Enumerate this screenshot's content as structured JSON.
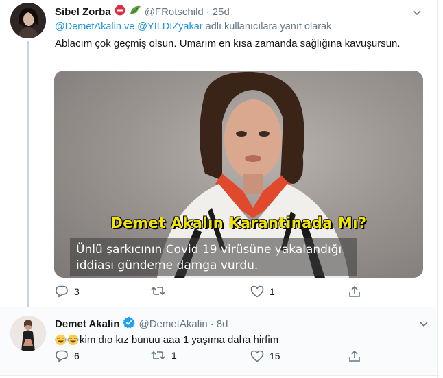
{
  "tweet1": {
    "name": "Sibel Zorba",
    "handle": "@FRotschild",
    "time": "25d",
    "reply_prefix": "",
    "reply_mention1": "@DemetAkalin",
    "reply_and": " ve ",
    "reply_mention2": "@YILDIZyakar",
    "reply_suffix": " adlı kullanıcılara yanıt olarak",
    "text": "Ablacım çok geçmiş olsun. Umarım en kısa zamanda sağlığına kavuşursun.",
    "media": {
      "headline": "Demet Akalın Karantinada Mı?",
      "caption": "Ünlü şarkıcının Covid 19 virüsüne yakalandığı iddiası  gündeme damga vurdu."
    },
    "reply_count": "3",
    "retweet_count": "",
    "like_count": "1",
    "badges": [
      "no-entry-icon",
      "leaf-icon"
    ]
  },
  "tweet2": {
    "name": "Demet Akalin",
    "handle": "@DemetAkalin",
    "time": "8d",
    "text": "kim dıo kız bunuu aaa 1 yaşıma daha hirfim",
    "emojis": [
      "laughing-crying-emoji",
      "laughing-crying-emoji"
    ],
    "reply_count": "6",
    "retweet_count": "1",
    "like_count": "15",
    "verified": true
  },
  "separator": "·",
  "colors": {
    "link": "#1b95e0",
    "muted": "#657786",
    "text": "#14171a",
    "verified": "#1da1f2",
    "headline": "#f2e600"
  }
}
